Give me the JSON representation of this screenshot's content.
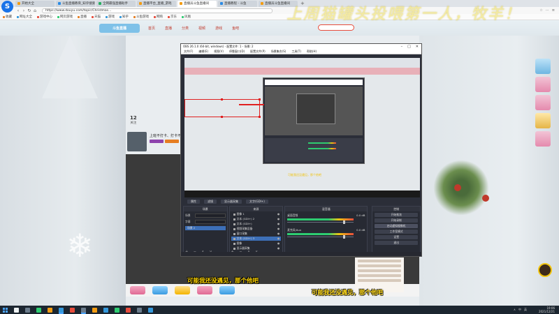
{
  "browser": {
    "logo": "S",
    "tabs": [
      {
        "label": "开始大全",
        "active": false
      },
      {
        "label": "斗鱼直播教育_知乎搜索",
        "active": false
      },
      {
        "label": "全网最强直播助手",
        "active": false
      },
      {
        "label": "直播平台_直播_游戏",
        "active": false
      },
      {
        "label": "直播员斗鱼直播间",
        "active": true
      },
      {
        "label": "直播教程 - 斗鱼",
        "active": false
      },
      {
        "label": "直播员斗鱼直播间",
        "active": false
      }
    ],
    "tab_add": "+",
    "nav": {
      "back": "‹",
      "forward": "›",
      "refresh": "↻",
      "home": "⌂"
    },
    "url": "https://www.douyu.com/topic/Christmas...",
    "addr_right": [
      "☆",
      "⋯",
      "≡"
    ],
    "bookmarks": [
      "收藏",
      "网址大全",
      "游戏中心",
      "网页游戏",
      "直播",
      "天猫",
      "游戏",
      "知乎",
      "斗鱼游戏",
      "网购",
      "京东",
      "凤凰"
    ]
  },
  "overlay_title": "上周猫罐头投喂第一人，牧羊！",
  "site": {
    "logo": "斗鱼直播",
    "nav": [
      "首页",
      "直播",
      "分类",
      "视频",
      "游戏",
      "鱼吧"
    ],
    "streamer": {
      "name": "上班不打卡、打卡不上班",
      "stat1_value": "12",
      "stat1_label": "关注"
    }
  },
  "obs": {
    "title": "OBS 26.1.0 (64-bit, windows) - 配置文件: 1 - 场景: 2",
    "window_controls": [
      "–",
      "□",
      "✕"
    ],
    "menu": [
      "文件(F)",
      "编辑(E)",
      "视图(V)",
      "停靠窗口(D)",
      "配置文件(P)",
      "场景集合(S)",
      "工具(T)",
      "帮助(H)"
    ],
    "nested_caption": "可能我还没遇见，那个他吧",
    "toolbar": [
      "属性",
      "滤镜",
      "显示器采集",
      "文字(GDI+)"
    ],
    "docks": {
      "scenes": {
        "title": "场景",
        "items": [
          "场景 2"
        ],
        "selected": 0
      },
      "properties": {
        "rows": [
          {
            "label": "场景",
            "value": ""
          },
          {
            "label": "字幕",
            "value": ""
          }
        ]
      },
      "sources": {
        "title": "来源",
        "items": [
          "图像 1",
          "文本 (GDI+) 2",
          "文本 (GDI+)",
          "视频采集设备",
          "窗口采集",
          "文本 (GDI+) 3",
          "图像",
          "显示器采集"
        ]
      },
      "mixer": {
        "title": "混音器",
        "channels": [
          {
            "name": "桌面音频",
            "db": "0.0 dB"
          },
          {
            "name": "麦克风/Aux",
            "db": "0.0 dB"
          }
        ]
      },
      "transitions": {
        "title": "场景过渡",
        "type": "淡入淡出",
        "duration": "300 ms"
      },
      "controls": {
        "title": "控制",
        "buttons": [
          "开始推流",
          "开始录制",
          "启动虚拟摄像机",
          "工作室模式",
          "设置",
          "退出"
        ]
      }
    },
    "dock_foot": "+ − ∧ ∨"
  },
  "subtitles": {
    "line1": "可能我还没遇见，那个他吧",
    "line2": "可能我还没遇见，那个他吧"
  },
  "taskbar": {
    "clock_time": "19:06",
    "clock_date": "2021/12/21",
    "tray": [
      "∧",
      "中",
      "英"
    ]
  }
}
